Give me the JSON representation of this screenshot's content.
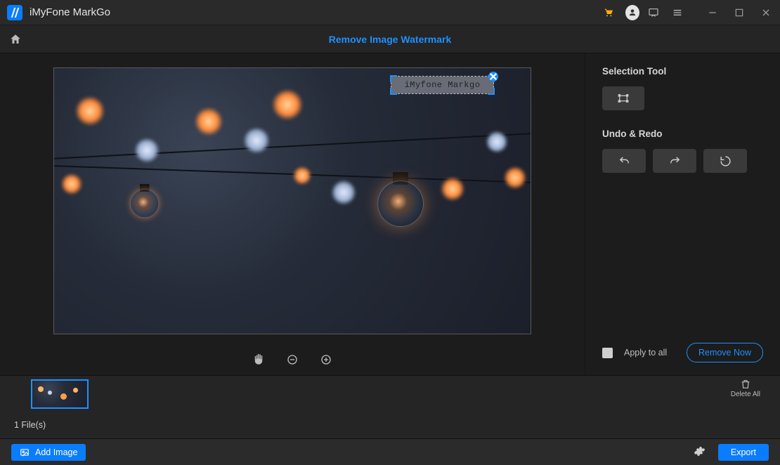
{
  "app": {
    "title": "iMyFone MarkGo"
  },
  "titlebar_icons": {
    "cart": "cart-icon",
    "account": "account-icon",
    "feedback": "feedback-icon",
    "menu": "menu-icon",
    "minimize": "minimize-icon",
    "maximize": "maximize-icon",
    "close": "close-icon"
  },
  "tab": {
    "active_title": "Remove Image Watermark"
  },
  "canvas": {
    "watermark_text": "iMyfone Markgo",
    "tools": {
      "pan": "hand-icon",
      "zoom_out": "zoom-out-icon",
      "zoom_in": "zoom-in-icon"
    }
  },
  "sidebar": {
    "selection_label": "Selection Tool",
    "undo_redo_label": "Undo & Redo",
    "apply_all_label": "Apply to all",
    "remove_now_label": "Remove Now"
  },
  "thumbstrip": {
    "delete_all_label": "Delete All",
    "file_count_label": "1 File(s)"
  },
  "bottombar": {
    "add_image_label": "Add Image",
    "export_label": "Export"
  },
  "colors": {
    "accent": "#1e90ff",
    "primary_btn": "#0a7cff"
  }
}
